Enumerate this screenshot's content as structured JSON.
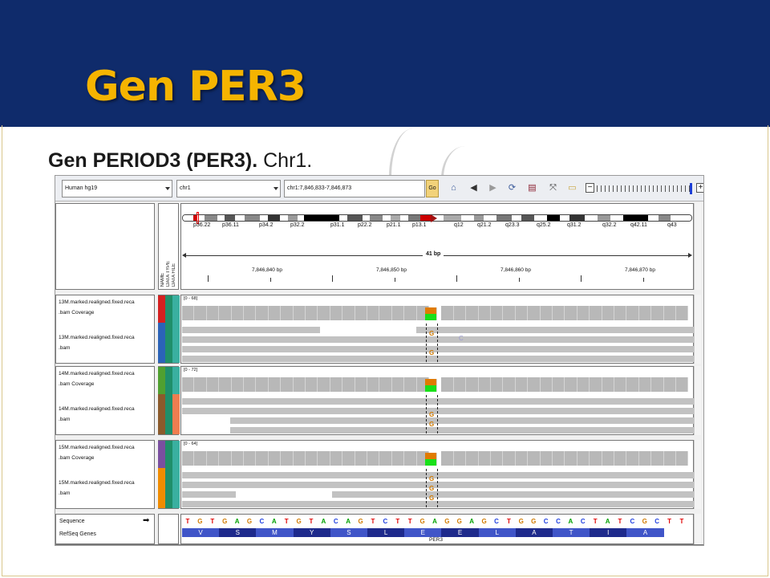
{
  "slide": {
    "title": "Gen PER3",
    "subtitle_bold": "Gen PERIOD3 (PER3).",
    "subtitle_rest": " Chr1."
  },
  "colors": {
    "header_bg": "#0f2b6b",
    "title": "#f5b400",
    "variant_base_G": "#d17a00",
    "coverage_ref": "#e07b00",
    "coverage_alt": "#19e019",
    "amino_dark": "#1e2a8c",
    "amino_light": "#4055c8"
  },
  "toolbar": {
    "genome": "Human hg19",
    "chromosome": "chr1",
    "locus": "chr1:7,846,833-7,846,873",
    "go_label": "Go",
    "icons": [
      "home-icon",
      "back-icon",
      "forward-icon",
      "refresh-icon",
      "roi-icon",
      "resize-icon",
      "popup-icon"
    ]
  },
  "header_panel": {
    "attribute_labels": [
      "NAME",
      "DATA TYPE",
      "DATA FILE"
    ],
    "ideogram_bands": [
      "p36.22",
      "p36.11",
      "p34.2",
      "p32.2",
      "p31.1",
      "p22.2",
      "p21.1",
      "p13.1",
      "q12",
      "q21.2",
      "q23.3",
      "q25.2",
      "q31.2",
      "q32.2",
      "q42.11",
      "q43"
    ],
    "span": "41 bp",
    "ruler_ticks": [
      "7,846,840 bp",
      "7,846,850 bp",
      "7,846,860 bp",
      "7,846,870 bp"
    ]
  },
  "samples": [
    {
      "coverage_name": "13M.marked.realigned.fixed.reca",
      "coverage_ext": ".bam Coverage",
      "alignment_name": "13M.marked.realigned.fixed.reca",
      "alignment_ext": ".bam",
      "range": "[0 - 68]",
      "variant_base": "G",
      "extra_base": "C"
    },
    {
      "coverage_name": "14M.marked.realigned.fixed.reca",
      "coverage_ext": ".bam Coverage",
      "alignment_name": "14M.marked.realigned.fixed.reca",
      "alignment_ext": ".bam",
      "range": "[0 - 72]",
      "variant_base": "G"
    },
    {
      "coverage_name": "15M.marked.realigned.fixed.reca",
      "coverage_ext": ".bam Coverage",
      "alignment_name": "15M.marked.realigned.fixed.reca",
      "alignment_ext": ".bam",
      "range": "[0 - 64]",
      "variant_base": "G"
    }
  ],
  "sequence_track": {
    "label": "Sequence",
    "strand_arrow": "➡",
    "bases": [
      "T",
      "G",
      "T",
      "G",
      "A",
      "G",
      "C",
      "A",
      "T",
      "G",
      "T",
      "A",
      "C",
      "A",
      "G",
      "T",
      "C",
      "T",
      "T",
      "G",
      "A",
      "G",
      "G",
      "A",
      "G",
      "C",
      "T",
      "G",
      "G",
      "C",
      "C",
      "A",
      "C",
      "T",
      "A",
      "T",
      "C",
      "G",
      "C",
      "T",
      "T"
    ]
  },
  "refseq_track": {
    "label": "RefSeq Genes",
    "amino_acids": [
      "V",
      "S",
      "M",
      "Y",
      "S",
      "L",
      "E",
      "E",
      "L",
      "A",
      "T",
      "I",
      "A"
    ],
    "gene_name": "PER3"
  }
}
